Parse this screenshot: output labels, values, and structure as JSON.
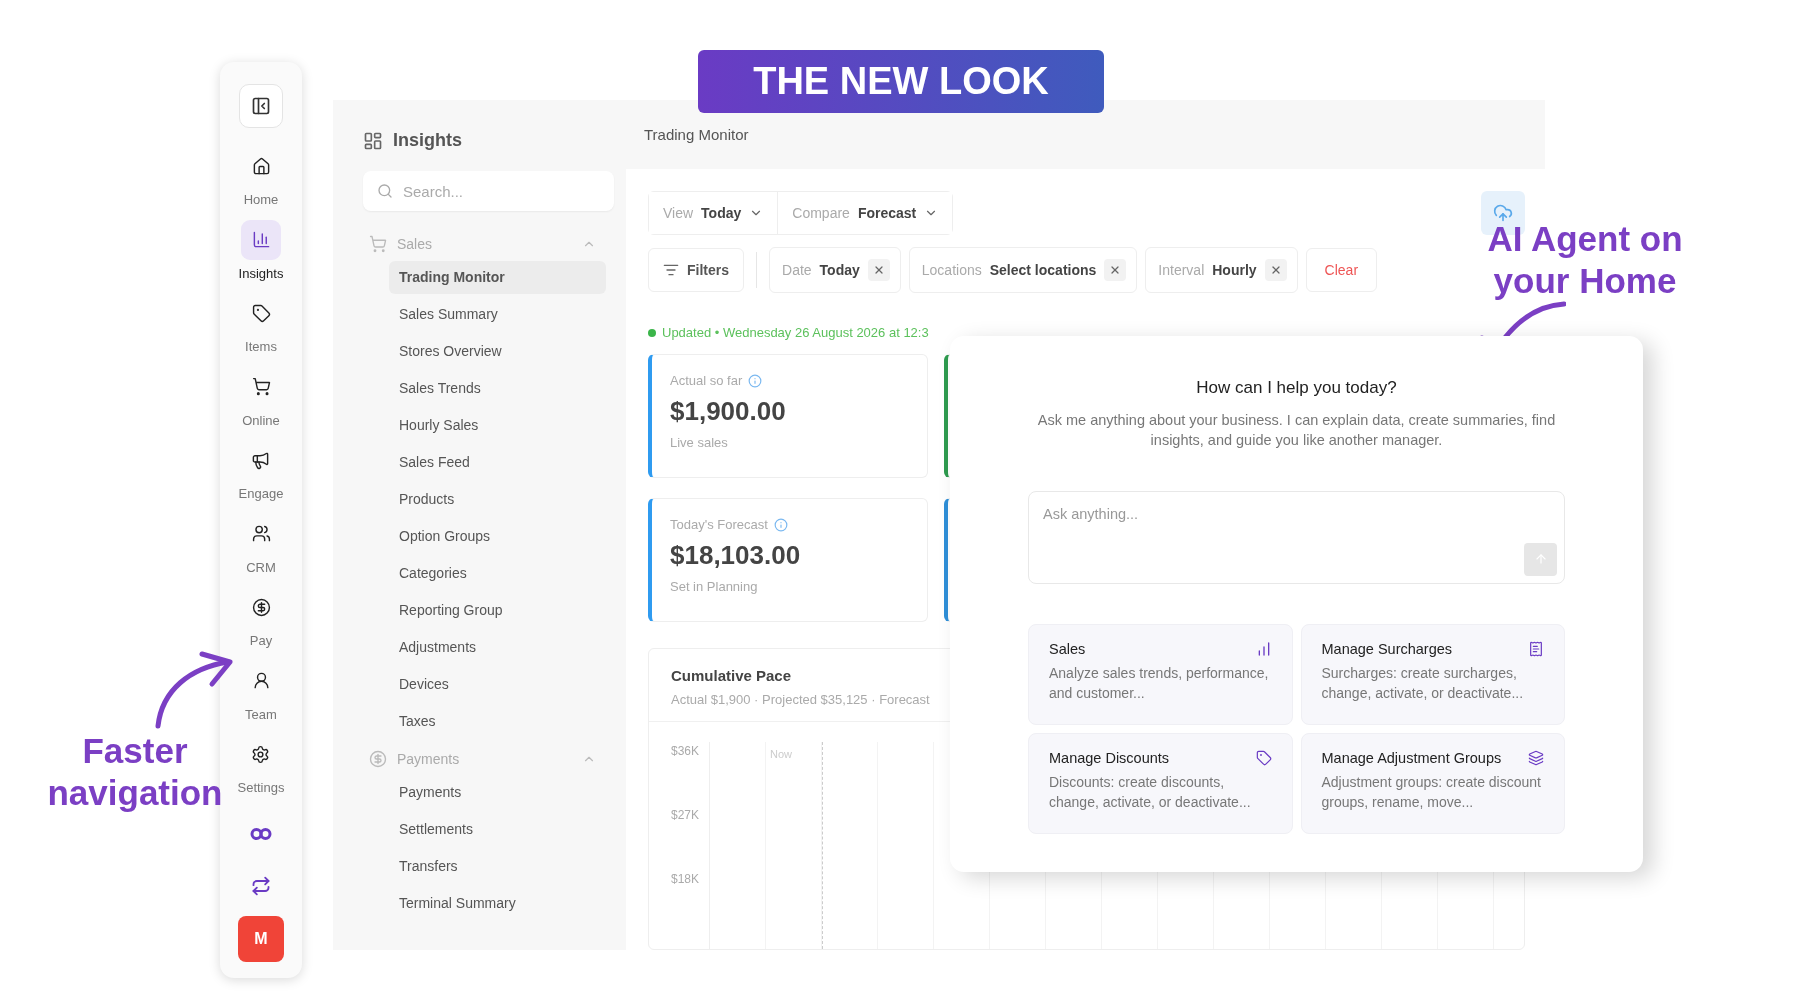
{
  "banner": {
    "title": "THE NEW LOOK"
  },
  "annotations": {
    "agent": "AI Agent on your Home",
    "navigation": "Faster navigation"
  },
  "rail": {
    "items": [
      {
        "label": "Home",
        "selected": false
      },
      {
        "label": "Insights",
        "selected": true
      },
      {
        "label": "Items",
        "selected": false
      },
      {
        "label": "Online",
        "selected": false
      },
      {
        "label": "Engage",
        "selected": false
      },
      {
        "label": "CRM",
        "selected": false
      },
      {
        "label": "Pay",
        "selected": false
      },
      {
        "label": "Team",
        "selected": false
      },
      {
        "label": "Settings",
        "selected": false
      }
    ],
    "avatar": "M"
  },
  "insights": {
    "title": "Insights",
    "search": {
      "placeholder": "Search..."
    },
    "groups": [
      {
        "name": "Sales",
        "expanded": true,
        "items": [
          {
            "label": "Trading Monitor",
            "selected": true
          },
          {
            "label": "Sales Summary",
            "selected": false
          },
          {
            "label": "Stores Overview",
            "selected": false
          },
          {
            "label": "Sales Trends",
            "selected": false
          },
          {
            "label": "Hourly Sales",
            "selected": false
          },
          {
            "label": "Sales Feed",
            "selected": false
          },
          {
            "label": "Products",
            "selected": false
          },
          {
            "label": "Option Groups",
            "selected": false
          },
          {
            "label": "Categories",
            "selected": false
          },
          {
            "label": "Reporting Group",
            "selected": false
          },
          {
            "label": "Adjustments",
            "selected": false
          },
          {
            "label": "Devices",
            "selected": false
          },
          {
            "label": "Taxes",
            "selected": false
          }
        ]
      },
      {
        "name": "Payments",
        "expanded": true,
        "items": [
          {
            "label": "Payments",
            "selected": false
          },
          {
            "label": "Settlements",
            "selected": false
          },
          {
            "label": "Transfers",
            "selected": false
          },
          {
            "label": "Terminal Summary",
            "selected": false
          }
        ]
      }
    ]
  },
  "main": {
    "title": "Trading Monitor",
    "view_controls": [
      {
        "label": "View",
        "value": "Today"
      },
      {
        "label": "Compare",
        "value": "Forecast"
      }
    ],
    "filters_button": "Filters",
    "chips": [
      {
        "label": "Date",
        "value": "Today"
      },
      {
        "label": "Locations",
        "value": "Select locations"
      },
      {
        "label": "Interval",
        "value": "Hourly"
      }
    ],
    "clear": "Clear",
    "updated": "Updated • Wednesday 26 August 2026 at 12:3",
    "stat_cards": [
      {
        "label": "Actual so far",
        "value": "$1,900.00",
        "note": "Live sales",
        "color": "#2f9bf0"
      },
      {
        "label": "Today's Forecast",
        "value": "$18,103.00",
        "note": "Set in Planning",
        "color": "#2f9bf0"
      }
    ],
    "covered_cards": [
      {
        "color": "#2e9b4f"
      },
      {
        "color": "#2f8fd8"
      }
    ],
    "pace": {
      "title": "Cumulative Pace",
      "subtitle": "Actual $1,900 · Projected $35,125 · Forecast",
      "y_labels": [
        "$36K",
        "$27K",
        "$18K"
      ],
      "marker": "Now"
    }
  },
  "assistant": {
    "heading": "How can I help you today?",
    "description": "Ask me anything about your business. I can explain data, create summaries, find insights, and guide you like another manager.",
    "input": {
      "placeholder": "Ask anything..."
    },
    "suggestions": [
      {
        "title": "Sales",
        "text": "Analyze sales trends, performance, and customer..."
      },
      {
        "title": "Manage Surcharges",
        "text": "Surcharges: create surcharges, change, activate, or deactivate..."
      },
      {
        "title": "Manage Discounts",
        "text": "Discounts: create discounts, change, activate, or deactivate..."
      },
      {
        "title": "Manage Adjustment Groups",
        "text": "Adjustment groups: create discount groups, rename, move..."
      }
    ]
  }
}
